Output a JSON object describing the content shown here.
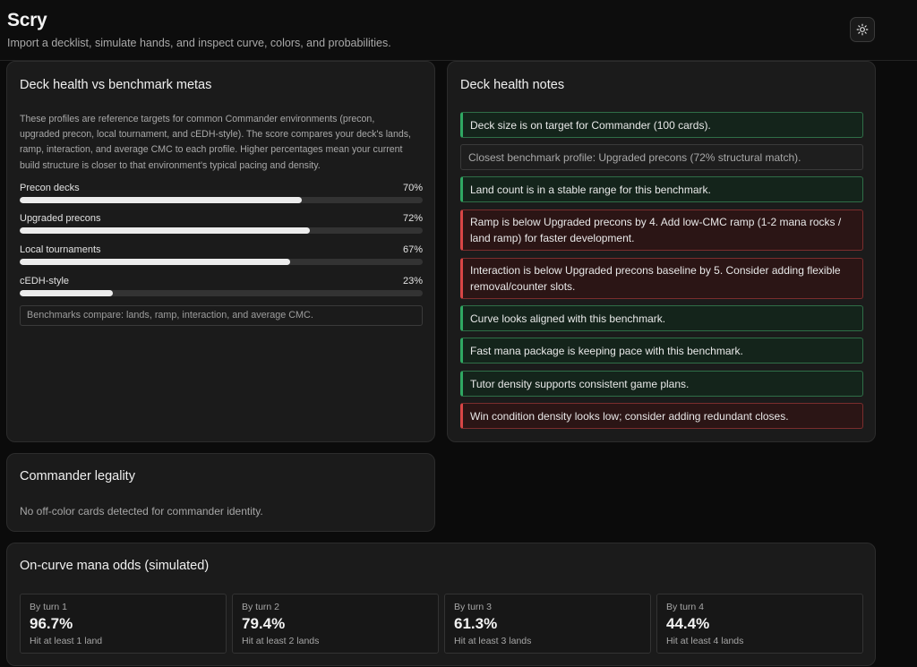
{
  "header": {
    "title": "Scry",
    "subtitle": "Import a decklist, simulate hands, and inspect curve, colors, and probabilities.",
    "theme_icon": "sun-icon"
  },
  "benchmarks": {
    "title": "Deck health vs benchmark metas",
    "description": "These profiles are reference targets for common Commander environments (precon, upgraded precon, local tournament, and cEDH-style). The score compares your deck's lands, ramp, interaction, and average CMC to each profile. Higher percentages mean your current build structure is closer to that environment's typical pacing and density.",
    "profiles": [
      {
        "label": "Precon decks",
        "percent_text": "70%",
        "value": 0.7
      },
      {
        "label": "Upgraded precons",
        "percent_text": "72%",
        "value": 0.72
      },
      {
        "label": "Local tournaments",
        "percent_text": "67%",
        "value": 0.67
      },
      {
        "label": "cEDH-style",
        "percent_text": "23%",
        "value": 0.23
      }
    ],
    "footnote": "Benchmarks compare: lands, ramp, interaction, and average CMC."
  },
  "notes": {
    "title": "Deck health notes",
    "items": [
      {
        "text": "Deck size is on target for Commander (100 cards).",
        "status": "ok"
      },
      {
        "text": "Closest benchmark profile: Upgraded precons (72% structural match).",
        "status": "neutral"
      },
      {
        "text": "Land count is in a stable range for this benchmark.",
        "status": "ok"
      },
      {
        "text": "Ramp is below Upgraded precons by 4. Add low-CMC ramp (1-2 mana rocks / land ramp) for faster development.",
        "status": "bad"
      },
      {
        "text": "Interaction is below Upgraded precons baseline by 5. Consider adding flexible removal/counter slots.",
        "status": "bad"
      },
      {
        "text": "Curve looks aligned with this benchmark.",
        "status": "ok"
      },
      {
        "text": "Fast mana package is keeping pace with this benchmark.",
        "status": "ok"
      },
      {
        "text": "Tutor density supports consistent game plans.",
        "status": "ok"
      },
      {
        "text": "Win condition density looks low; consider adding redundant closes.",
        "status": "bad"
      }
    ]
  },
  "legality": {
    "title": "Commander legality",
    "text": "No off-color cards detected for commander identity."
  },
  "odds": {
    "title": "On-curve mana odds (simulated)",
    "items": [
      {
        "label": "By turn 1",
        "value": "96.7%",
        "sub": "Hit at least 1 land"
      },
      {
        "label": "By turn 2",
        "value": "79.4%",
        "sub": "Hit at least 2 lands"
      },
      {
        "label": "By turn 3",
        "value": "61.3%",
        "sub": "Hit at least 3 lands"
      },
      {
        "label": "By turn 4",
        "value": "44.4%",
        "sub": "Hit at least 4 lands"
      }
    ]
  },
  "colors": {
    "ok_accent": "#2fa862",
    "bad_accent": "#d84545"
  }
}
